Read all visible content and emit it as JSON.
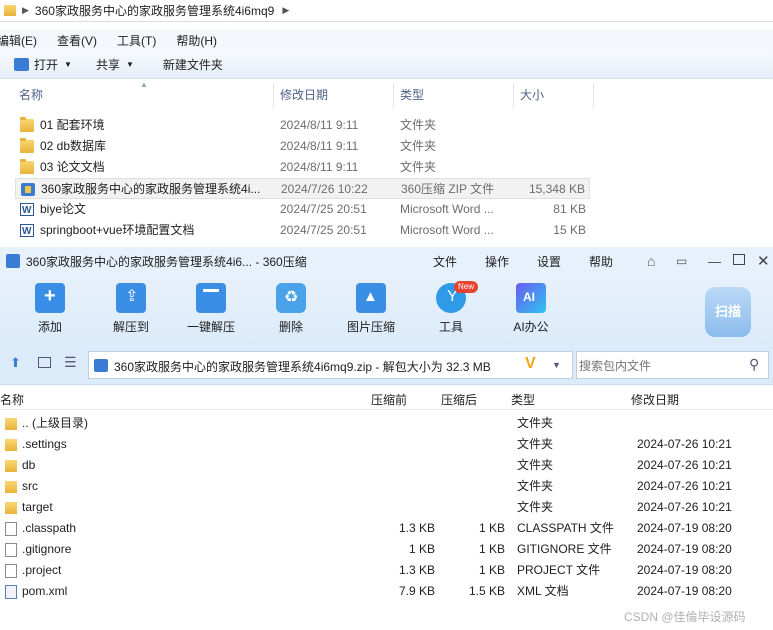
{
  "explorer": {
    "address": "360家政服务中心的家政服务管理系统4i6mq9",
    "menu": [
      "编辑(E)",
      "查看(V)",
      "工具(T)",
      "帮助(H)"
    ],
    "commands": {
      "open": "打开",
      "share": "共享",
      "new_folder": "新建文件夹"
    },
    "columns": {
      "name": "名称",
      "date": "修改日期",
      "type": "类型",
      "size": "大小"
    },
    "rows": [
      {
        "name": "01 配套环境",
        "date": "2024/8/11 9:11",
        "type": "文件夹",
        "size": "",
        "icon": "folder-icon"
      },
      {
        "name": "02 db数据库",
        "date": "2024/8/11 9:11",
        "type": "文件夹",
        "size": "",
        "icon": "folder-icon"
      },
      {
        "name": "03 论文文档",
        "date": "2024/8/11 9:11",
        "type": "文件夹",
        "size": "",
        "icon": "folder-icon"
      },
      {
        "name": "360家政服务中心的家政服务管理系统4i...",
        "date": "2024/7/26 10:22",
        "type": "360压缩 ZIP 文件",
        "size": "15,348 KB",
        "icon": "zip-icon"
      },
      {
        "name": "biye论文",
        "date": "2024/7/25 20:51",
        "type": "Microsoft Word ...",
        "size": "81 KB",
        "icon": "word-icon"
      },
      {
        "name": "springboot+vue环境配置文档",
        "date": "2024/7/25 20:51",
        "type": "Microsoft Word ...",
        "size": "15 KB",
        "icon": "word-icon"
      }
    ]
  },
  "zip": {
    "title": "360家政服务中心的家政服务管理系统4i6... - 360压缩",
    "menu": [
      "文件",
      "操作",
      "设置",
      "帮助"
    ],
    "tools": [
      "添加",
      "解压到",
      "一键解压",
      "删除",
      "图片压缩",
      "工具",
      "AI办公"
    ],
    "new_badge": "New",
    "scan": "扫描",
    "path": "360家政服务中心的家政服务管理系统4i6mq9.zip - 解包大小为 32.3 MB",
    "search_placeholder": "搜索包内文件",
    "columns": {
      "name": "名称",
      "compressed": "压缩前",
      "original": "压缩后",
      "type": "类型",
      "date": "修改日期"
    },
    "rows": [
      {
        "name": ".. (上级目录)",
        "csize": "",
        "osize": "",
        "type": "文件夹",
        "date": "",
        "icon": "folder"
      },
      {
        "name": ".settings",
        "csize": "",
        "osize": "",
        "type": "文件夹",
        "date": "2024-07-26 10:21",
        "icon": "folder"
      },
      {
        "name": "db",
        "csize": "",
        "osize": "",
        "type": "文件夹",
        "date": "2024-07-26 10:21",
        "icon": "folder"
      },
      {
        "name": "src",
        "csize": "",
        "osize": "",
        "type": "文件夹",
        "date": "2024-07-26 10:21",
        "icon": "folder"
      },
      {
        "name": "target",
        "csize": "",
        "osize": "",
        "type": "文件夹",
        "date": "2024-07-26 10:21",
        "icon": "folder"
      },
      {
        "name": ".classpath",
        "csize": "1.3 KB",
        "osize": "1 KB",
        "type": "CLASSPATH 文件",
        "date": "2024-07-19 08:20",
        "icon": "file"
      },
      {
        "name": ".gitignore",
        "csize": "1 KB",
        "osize": "1 KB",
        "type": "GITIGNORE 文件",
        "date": "2024-07-19 08:20",
        "icon": "file"
      },
      {
        "name": ".project",
        "csize": "1.3 KB",
        "osize": "1 KB",
        "type": "PROJECT 文件",
        "date": "2024-07-19 08:20",
        "icon": "file"
      },
      {
        "name": "pom.xml",
        "csize": "7.9 KB",
        "osize": "1.5 KB",
        "type": "XML 文档",
        "date": "2024-07-19 08:20",
        "icon": "xml"
      }
    ],
    "watermark": "CSDN @佳倫毕设源码"
  }
}
